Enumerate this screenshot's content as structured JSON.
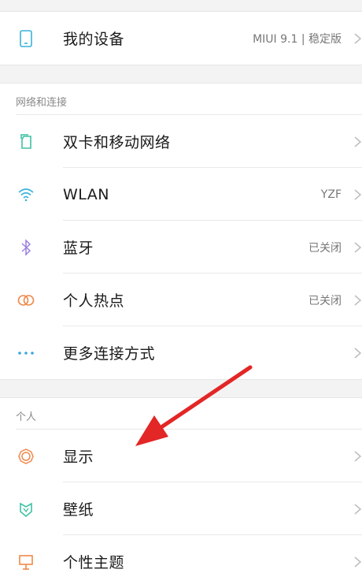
{
  "device": {
    "label": "我的设备",
    "value": "MIUI 9.1 | 稳定版",
    "icon": "phone-icon"
  },
  "network_section": {
    "header": "网络和连接",
    "items": [
      {
        "label": "双卡和移动网络",
        "value": "",
        "icon": "sim-card-icon",
        "color": "#3ec2a3"
      },
      {
        "label": "WLAN",
        "value": "YZF",
        "icon": "wifi-icon",
        "color": "#3ab3d8"
      },
      {
        "label": "蓝牙",
        "value": "已关闭",
        "icon": "bluetooth-icon",
        "color": "#9a7fe0"
      },
      {
        "label": "个人热点",
        "value": "已关闭",
        "icon": "hotspot-icon",
        "color": "#f0884a"
      },
      {
        "label": "更多连接方式",
        "value": "",
        "icon": "more-dots-icon",
        "color": "#3aa5e0"
      }
    ]
  },
  "personal_section": {
    "header": "个人",
    "items": [
      {
        "label": "显示",
        "value": "",
        "icon": "brightness-icon",
        "color": "#f0884a"
      },
      {
        "label": "壁纸",
        "value": "",
        "icon": "wallpaper-icon",
        "color": "#3ec2a3"
      },
      {
        "label": "个性主题",
        "value": "",
        "icon": "theme-icon",
        "color": "#f0884a"
      }
    ]
  },
  "annotation": {
    "icon": "red-arrow-pointer",
    "color": "#e32626"
  }
}
